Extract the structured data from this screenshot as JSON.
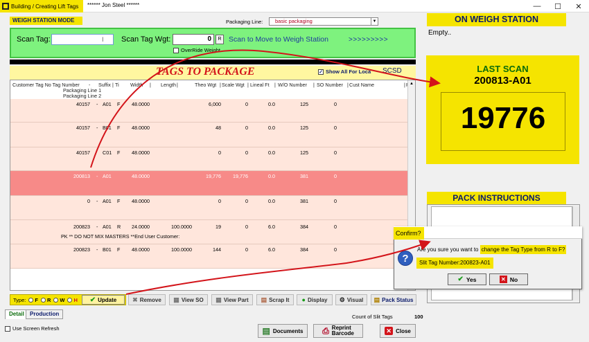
{
  "window": {
    "app_title": "Building / Creating Lift Tags",
    "user": "****** Jon Steel ******"
  },
  "header": {
    "mode": "WEIGH STATION MODE",
    "packaging_line_label": "Packaging Line:",
    "packaging_line_value": "basic packaging"
  },
  "scan": {
    "scan_tag_label": "Scan Tag:",
    "scan_tag_value": "",
    "scan_wgt_label": "Scan Tag Wgt:",
    "scan_wgt_value": "0",
    "r_button": "R",
    "move_label": "Scan to Move to Weigh Station",
    "arrows": ">>>>>>>>>",
    "override_label": "OverRide Weight"
  },
  "tags": {
    "title": "TAGS TO PACKAGE",
    "show_all_label": "Show All For Loca",
    "code": "SCSD"
  },
  "grid": {
    "headers": {
      "customer_tag": "Customer Tag No Tag Number",
      "dash": "-",
      "suffix": "Suffix",
      "ti": "Ti",
      "width": "Width",
      "length": "Length",
      "theo": "Theo Wgt",
      "scale": "Scale Wgt",
      "lineal": "Lineal Ft",
      "wo": "W/O Number",
      "so": "SO Number",
      "cust": "Cust Name",
      "p": "P",
      "pipe": "|",
      "pl1": "Packaging Line 1",
      "pl2": "Packaging Line 2"
    },
    "rows": [
      {
        "tag": "40157",
        "dash": "-",
        "suffix": "A01",
        "t": "F",
        "width": "48.0000",
        "length": "",
        "theo": "6,000",
        "scale": "0",
        "lineal": "0.0",
        "wo": "125",
        "so": "0"
      },
      {
        "tag": "40157",
        "dash": "-",
        "suffix": "B01",
        "t": "F",
        "width": "48.0000",
        "length": "",
        "theo": "48",
        "scale": "0",
        "lineal": "0.0",
        "wo": "125",
        "so": "0"
      },
      {
        "tag": "40157",
        "dash": "",
        "suffix": "C01",
        "t": "F",
        "width": "48.0000",
        "length": "",
        "theo": "0",
        "scale": "0",
        "lineal": "0.0",
        "wo": "125",
        "so": "0"
      },
      {
        "tag": "200813",
        "dash": "-",
        "suffix": "A01",
        "t": "",
        "width": "48.0000",
        "length": "",
        "theo": "19,776",
        "scale": "19,776",
        "lineal": "0.0",
        "wo": "381",
        "so": "0"
      },
      {
        "tag": "0",
        "dash": "-",
        "suffix": "A01",
        "t": "F",
        "width": "48.0000",
        "length": "",
        "theo": "0",
        "scale": "0",
        "lineal": "0.0",
        "wo": "381",
        "so": "0"
      },
      {
        "tag": "200823",
        "dash": "-",
        "suffix": "A01",
        "t": "R",
        "width": "24.0000",
        "length": "100.0000",
        "theo": "19",
        "scale": "0",
        "lineal": "6.0",
        "wo": "384",
        "so": "0"
      },
      {
        "tag": "200823",
        "dash": "-",
        "suffix": "B01",
        "t": "F",
        "width": "48.0000",
        "length": "100.0000",
        "theo": "144",
        "scale": "0",
        "lineal": "6.0",
        "wo": "384",
        "so": "0"
      }
    ],
    "note": "PK ** DO NOT MIX MASTERS **End User Customer:"
  },
  "toolbar": {
    "type_label": "Type:",
    "radios": [
      "F",
      "R",
      "W",
      "H"
    ],
    "update": "Update",
    "remove": "Remove",
    "view_so": "View SO",
    "view_part": "View Part",
    "scrap": "Scrap It",
    "display": "Display",
    "visual": "Visual",
    "pack_status": "Pack Status"
  },
  "tabs": {
    "detail": "Detail",
    "production": "Production"
  },
  "footer": {
    "count_label": "Count of Slit Tags",
    "count_value": "100",
    "refresh_label": "Use Screen Refresh",
    "documents": "Documents",
    "reprint_line1": "Reprint",
    "reprint_line2": "Barcode",
    "close": "Close"
  },
  "right": {
    "on_weigh": "ON WEIGH STATION",
    "empty": "Empty..",
    "last_scan_label": "LAST SCAN",
    "last_scan_tag": "200813-A01",
    "last_scan_weight": "19776",
    "pack_instructions": "PACK INSTRUCTIONS"
  },
  "dialog": {
    "title": "Confirm?",
    "msg_prefix": "Are you sure you want to",
    "msg_highlight": "change the Tag Type from R to F?",
    "slit_tag": "Slit Tag Number:200823-A01",
    "yes": "Yes",
    "no": "No"
  },
  "colors": {
    "highlight_yellow": "#f5e400",
    "scan_green": "#7ef27e",
    "row_pink": "#ffe6dc",
    "row_selected": "#f78a88",
    "title_red": "#d3141a",
    "arrow_red": "#d3141a"
  }
}
